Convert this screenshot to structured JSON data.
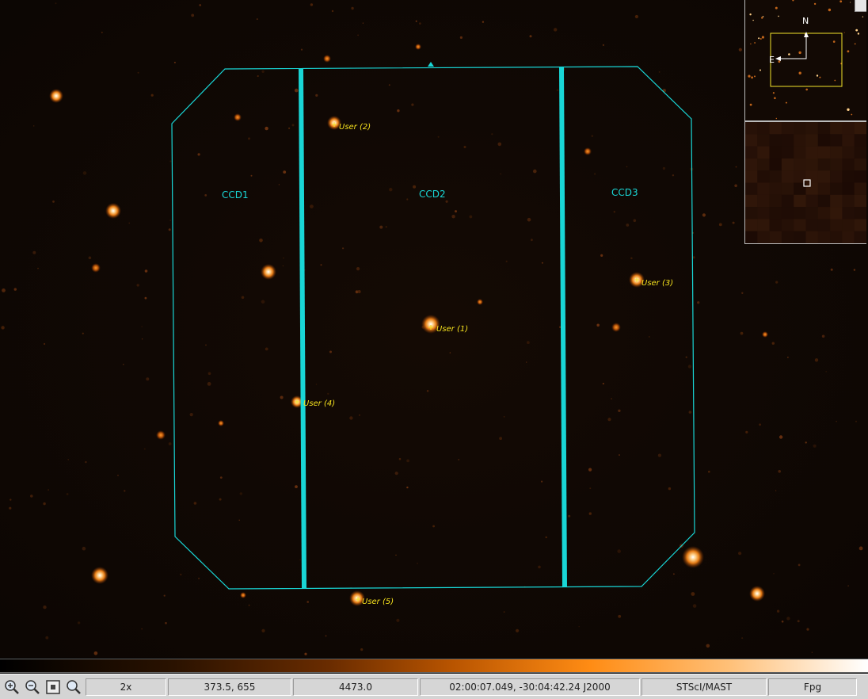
{
  "overlay": {
    "ccd_labels": [
      "CCD1",
      "CCD2",
      "CCD3"
    ],
    "user_markers": [
      "User (1)",
      "User (2)",
      "User (3)",
      "User (4)",
      "User (5)"
    ]
  },
  "panner": {
    "north_label": "N",
    "east_label": "E"
  },
  "toolbar": {
    "zoom_in_icon": "zoom-in-icon",
    "zoom_out_icon": "zoom-out-icon",
    "zoom_fit_icon": "zoom-fit-icon",
    "zoom_actual_icon": "magnify-icon"
  },
  "status": {
    "zoom": "2x",
    "pixel_coords": "373.5, 655",
    "pixel_value": "4473.0",
    "wcs": "02:00:07.049, -30:04:42.24 J2000",
    "source": "STScI/MAST",
    "filter": "Fpg"
  },
  "colors": {
    "footprint": "#19d6d6",
    "marker": "#f5e11e",
    "colormap_high": "#ff8c14"
  }
}
